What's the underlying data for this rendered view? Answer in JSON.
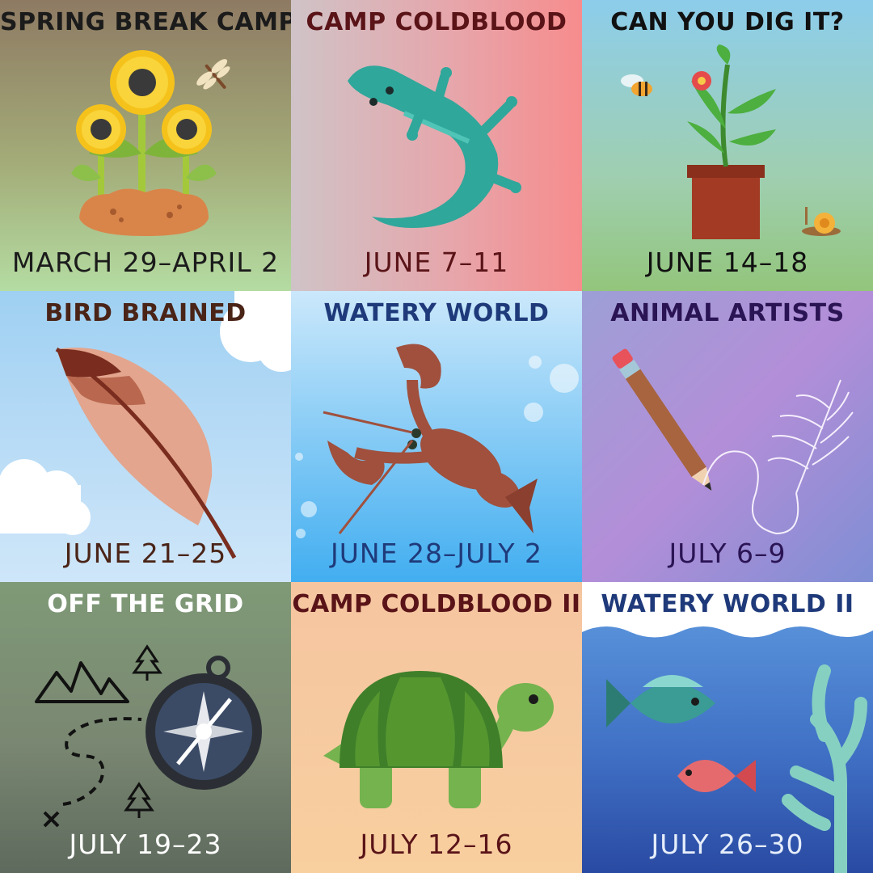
{
  "tiles": [
    {
      "title": "SPRING BREAK CAMP",
      "dates": "MARCH 29–APRIL 2",
      "title_color": "#1b1b1b",
      "date_color": "#1b1b1b",
      "icon": "sunflowers-icon"
    },
    {
      "title": "CAMP COLDBLOOD",
      "dates": "JUNE 7–11",
      "title_color": "#5a1418",
      "date_color": "#5a1418",
      "icon": "lizard-icon"
    },
    {
      "title": "CAN YOU DIG IT?",
      "dates": "JUNE 14–18",
      "title_color": "#111111",
      "date_color": "#111111",
      "icon": "potted-plant-icon"
    },
    {
      "title": "BIRD BRAINED",
      "dates": "JUNE 21–25",
      "title_color": "#4a2417",
      "date_color": "#4a2417",
      "icon": "feather-icon"
    },
    {
      "title": "WATERY WORLD",
      "dates": "JUNE 28–JULY 2",
      "title_color": "#1f3a7a",
      "date_color": "#1f3a7a",
      "icon": "lobster-icon"
    },
    {
      "title": "ANIMAL ARTISTS",
      "dates": "JULY 6–9",
      "title_color": "#2b1454",
      "date_color": "#2b1454",
      "icon": "pencil-drawing-icon"
    },
    {
      "title": "OFF THE GRID",
      "dates": "JULY 19–23",
      "title_color": "#ffffff",
      "date_color": "#ffffff",
      "icon": "compass-map-icon"
    },
    {
      "title": "CAMP COLDBLOOD II",
      "dates": "JULY 12–16",
      "title_color": "#5a1418",
      "date_color": "#5a1418",
      "icon": "turtle-icon"
    },
    {
      "title": "WATERY WORLD II",
      "dates": "JULY 26–30",
      "title_color": "#1f3a7a",
      "date_color": "#e6eefb",
      "icon": "fish-coral-icon"
    }
  ]
}
